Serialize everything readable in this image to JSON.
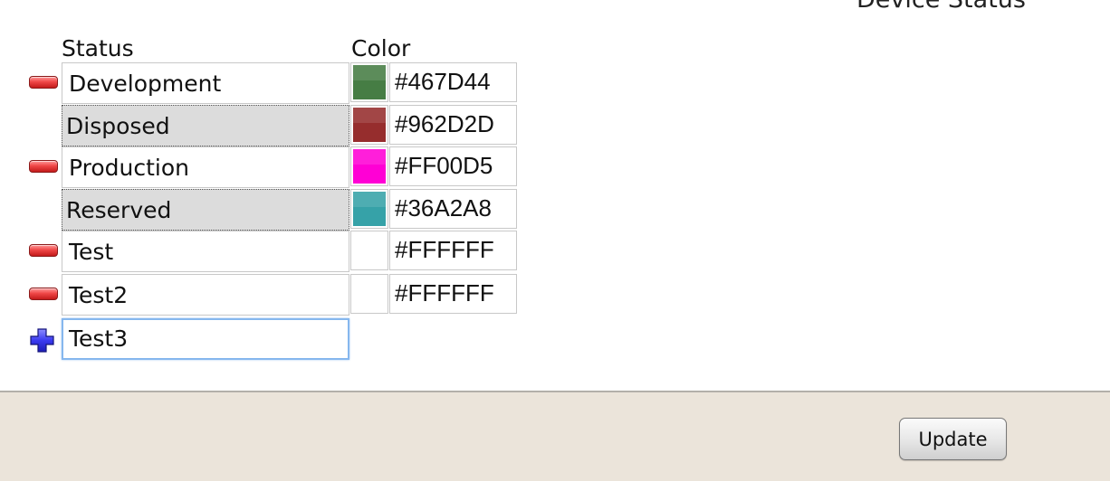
{
  "page": {
    "title": "Device Status"
  },
  "table": {
    "status_header": "Status",
    "color_header": "Color"
  },
  "rows": [
    {
      "status": "Development",
      "editable": true,
      "removable": true,
      "color_hex": "#467D44"
    },
    {
      "status": "Disposed",
      "editable": false,
      "removable": false,
      "color_hex": "#962D2D"
    },
    {
      "status": "Production",
      "editable": true,
      "removable": true,
      "color_hex": "#FF00D5"
    },
    {
      "status": "Reserved",
      "editable": false,
      "removable": false,
      "color_hex": "#36A2A8"
    },
    {
      "status": "Test",
      "editable": true,
      "removable": true,
      "color_hex": "#FFFFFF"
    },
    {
      "status": "Test2",
      "editable": true,
      "removable": true,
      "color_hex": "#FFFFFF"
    }
  ],
  "new_row": {
    "status": "Test3"
  },
  "icons": {
    "remove": "minus-icon",
    "add": "plus-icon"
  },
  "footer": {
    "update_label": "Update"
  }
}
